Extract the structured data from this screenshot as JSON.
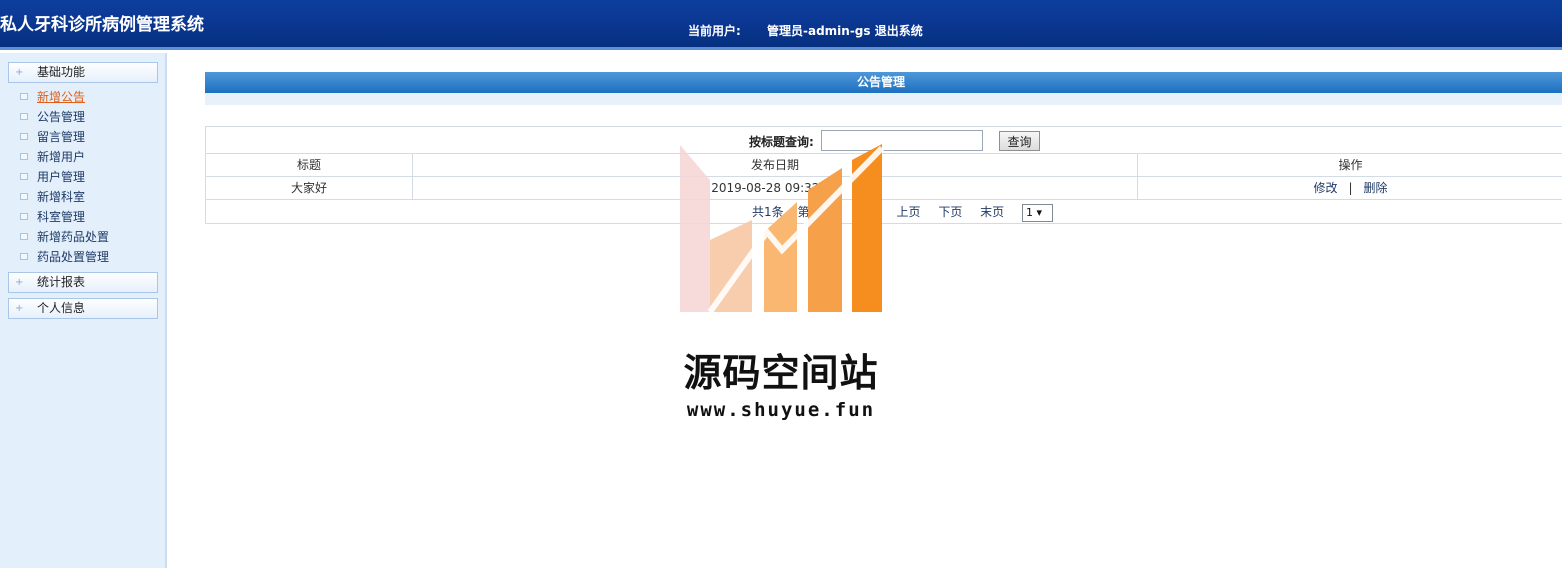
{
  "app": {
    "title": "私人牙科诊所病例管理系统",
    "current_user_label": "当前用户:",
    "user_name": "管理员-admin-gs",
    "logout_label": "退出系统"
  },
  "sidebar": {
    "groups": [
      {
        "label": "基础功能",
        "items": [
          {
            "label": "新增公告",
            "active": true
          },
          {
            "label": "公告管理"
          },
          {
            "label": "留言管理"
          },
          {
            "label": "新增用户"
          },
          {
            "label": "用户管理"
          },
          {
            "label": "新增科室"
          },
          {
            "label": "科室管理"
          },
          {
            "label": "新增药品处置"
          },
          {
            "label": "药品处置管理"
          }
        ]
      },
      {
        "label": "统计报表"
      },
      {
        "label": "个人信息"
      }
    ]
  },
  "main": {
    "panel_title": "公告管理",
    "search": {
      "label": "按标题查询:",
      "value": "",
      "button": "查询"
    },
    "table": {
      "columns": [
        "标题",
        "发布日期",
        "操作"
      ],
      "rows": [
        {
          "title": "大家好",
          "date": "2019-08-28 09:32:11",
          "edit": "修改",
          "sep": "|",
          "delete": "删除"
        }
      ]
    },
    "pager": {
      "total": "共1条",
      "page": "第1/1页",
      "first": "首页",
      "prev": "上页",
      "next": "下页",
      "last": "末页",
      "select_value": "1 ▾"
    }
  },
  "watermark": {
    "title": "源码空间站",
    "url": "www.shuyue.fun",
    "colors": [
      "#f6d5d3",
      "#f7c8a4",
      "#f9b772",
      "#f7a04a",
      "#f58d1f"
    ]
  }
}
